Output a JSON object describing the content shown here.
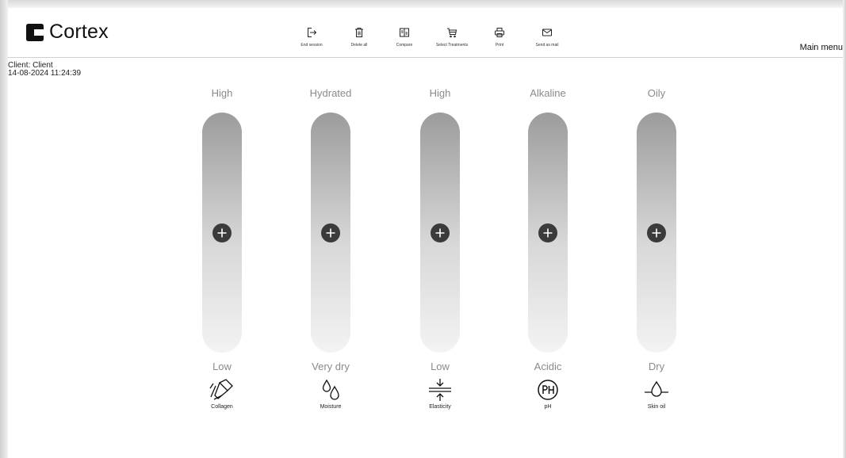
{
  "app": {
    "logo_text": "Cortex"
  },
  "toolbar": {
    "items": [
      {
        "label": "End session",
        "icon": "exit-icon"
      },
      {
        "label": "Delete all",
        "icon": "trash-icon"
      },
      {
        "label": "Compare",
        "icon": "compare-icon"
      },
      {
        "label": "Select Treatments",
        "icon": "cart-icon"
      },
      {
        "label": "Print",
        "icon": "printer-icon"
      },
      {
        "label": "Send as mail",
        "icon": "mail-icon"
      }
    ]
  },
  "main_menu_label": "Main menu",
  "client": {
    "line1": "Client: Client",
    "line2": "14-08-2024 11:24:39"
  },
  "metrics": [
    {
      "name": "Collagen",
      "top": "High",
      "bottom": "Low",
      "icon": "flashlight-icon",
      "level": 0.5
    },
    {
      "name": "Moisture",
      "top": "Hydrated",
      "bottom": "Very dry",
      "icon": "droplets-icon",
      "level": 0.5
    },
    {
      "name": "Elasticity",
      "top": "High",
      "bottom": "Low",
      "icon": "compress-arrows-icon",
      "level": 0.5
    },
    {
      "name": "pH",
      "top": "Alkaline",
      "bottom": "Acidic",
      "icon": "ph-icon",
      "level": 0.5
    },
    {
      "name": "Skin oil",
      "top": "Oily",
      "bottom": "Dry",
      "icon": "oil-drop-icon",
      "level": 0.5
    }
  ],
  "colors": {
    "knob": "#3b3b3b",
    "track_top": "#9c9c9c",
    "track_bottom": "#f3f3f3",
    "label_gray": "#8a8a8a"
  }
}
